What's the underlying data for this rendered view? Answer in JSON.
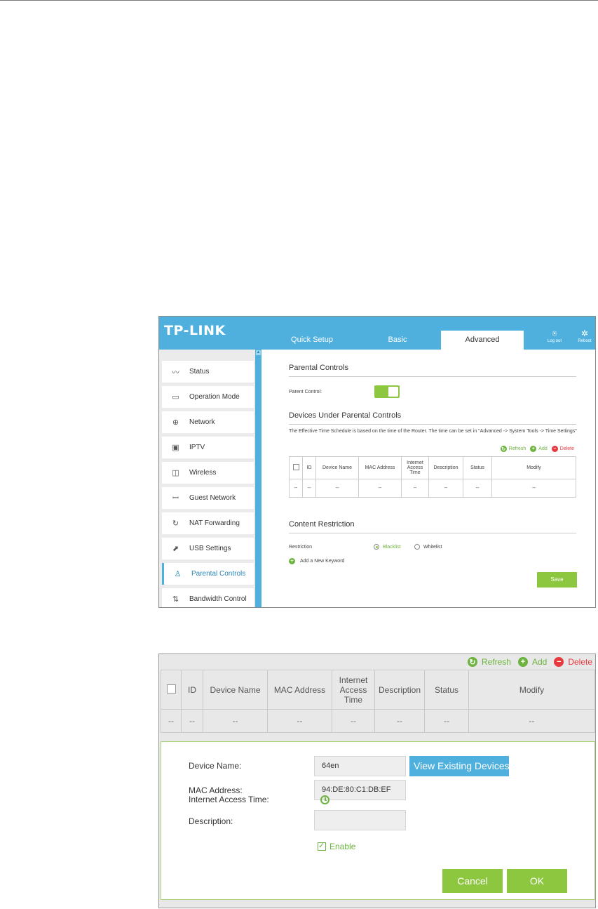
{
  "header": {
    "logo": "TP-LINK",
    "tabs": [
      "Quick Setup",
      "Basic",
      "Advanced"
    ],
    "active_tab": "Advanced",
    "logout_label": "Log out",
    "reboot_label": "Reboot"
  },
  "sidebar": {
    "items": [
      {
        "label": "Status",
        "icon": "status-icon"
      },
      {
        "label": "Operation Mode",
        "icon": "monitor-icon"
      },
      {
        "label": "Network",
        "icon": "globe-icon"
      },
      {
        "label": "IPTV",
        "icon": "tv-icon"
      },
      {
        "label": "Wireless",
        "icon": "wireless-icon"
      },
      {
        "label": "Guest Network",
        "icon": "guest-icon"
      },
      {
        "label": "NAT Forwarding",
        "icon": "nat-icon"
      },
      {
        "label": "USB Settings",
        "icon": "usb-icon"
      },
      {
        "label": "Parental Controls",
        "icon": "parental-icon"
      },
      {
        "label": "Bandwidth Control",
        "icon": "bandwidth-icon"
      }
    ],
    "active": "Parental Controls"
  },
  "parental": {
    "title": "Parental Controls",
    "parent_control_label": "Parent Control:",
    "toggle_on": true,
    "devices_title": "Devices Under Parental Controls",
    "note": "The Effective Time Schedule is based on the time of the Router. The time can be set in \"Advanced -> System Tools -> Time Settings\"",
    "actions": {
      "refresh": "Refresh",
      "add": "Add",
      "delete": "Delete"
    },
    "columns": [
      "ID",
      "Device Name",
      "MAC Address",
      "Internet Access Time",
      "Description",
      "Status",
      "Modify"
    ],
    "row": [
      "--",
      "--",
      "--",
      "--",
      "--",
      "--",
      "--",
      "--"
    ],
    "content_title": "Content Restriction",
    "restriction_label": "Restriction",
    "options": [
      "Blacklist",
      "Whitelist"
    ],
    "selected_option": "Blacklist",
    "add_keyword": "Add a New Keyword",
    "save": "Save"
  },
  "panel2": {
    "actions": {
      "refresh": "Refresh",
      "add": "Add",
      "delete": "Delete"
    },
    "columns": [
      "ID",
      "Device Name",
      "MAC Address",
      "Internet Access Time",
      "Description",
      "Status",
      "Modify"
    ],
    "row": [
      "--",
      "--",
      "--",
      "--",
      "--",
      "--",
      "--",
      "--"
    ],
    "form": {
      "device_name_label": "Device Name:",
      "device_name_value": "64en",
      "view_devices_button": "View Existing Devices",
      "mac_label": "MAC Address:",
      "mac_value": "94:DE:80:C1:DB:EF",
      "access_time_label": "Internet Access Time:",
      "description_label": "Description:",
      "description_value": "",
      "enable_label": "Enable",
      "enable_checked": true,
      "cancel": "Cancel",
      "ok": "OK"
    }
  },
  "colors": {
    "brand_blue": "#4fb0dd",
    "green": "#8dc63f",
    "red": "#e8393f"
  }
}
